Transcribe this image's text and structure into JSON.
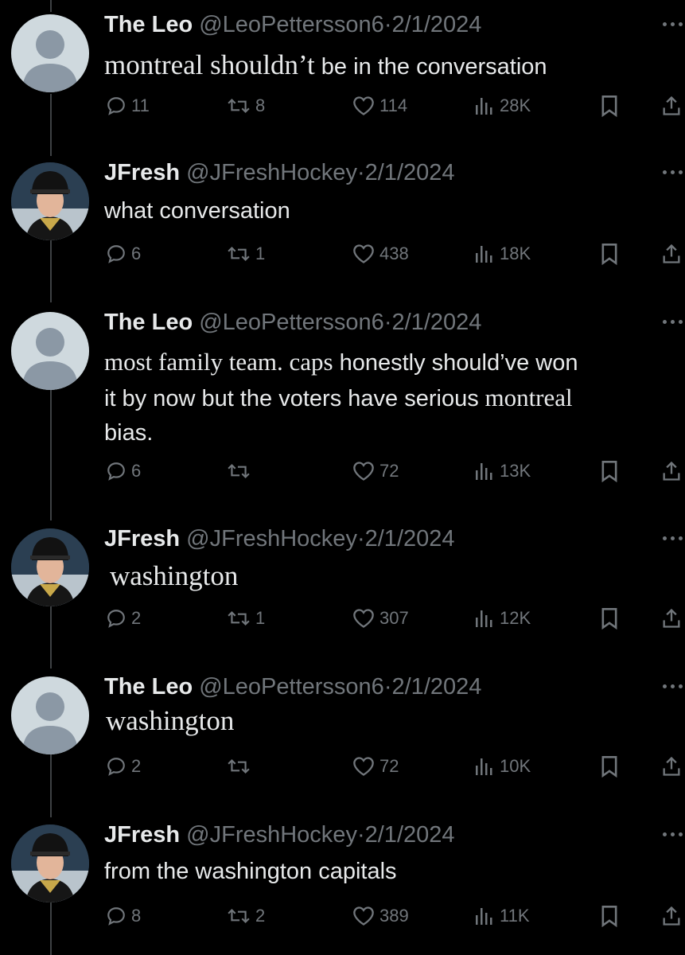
{
  "tweets": [
    {
      "author": "The Leo",
      "handle": "@LeoPettersson6",
      "date": "2/1/2024",
      "avatar": "default-avatar",
      "text_parts": [
        {
          "text": "montreal shouldn’t",
          "style": "serif"
        },
        {
          "text": " be in the conversation",
          "style": "sans"
        }
      ],
      "replies": "11",
      "retweets": "8",
      "likes": "114",
      "views": "28K"
    },
    {
      "author": "JFresh",
      "handle": "@JFreshHockey",
      "date": "2/1/2024",
      "avatar": "hockey-player-photo",
      "text_parts": [
        {
          "text": "what conversation",
          "style": "sans"
        }
      ],
      "replies": "6",
      "retweets": "1",
      "likes": "438",
      "views": "18K"
    },
    {
      "author": "The Leo",
      "handle": "@LeoPettersson6",
      "date": "2/1/2024",
      "avatar": "default-avatar",
      "text_lines": [
        [
          {
            "text": "most family team. caps",
            "style": "serif"
          },
          {
            "text": " honestly should’ve won",
            "style": "sans"
          }
        ],
        [
          {
            "text": "it by now but the voters have serious",
            "style": "sans"
          },
          {
            "text": " montreal",
            "style": "serif"
          }
        ],
        [
          {
            "text": "bias.",
            "style": "sans"
          }
        ]
      ],
      "replies": "6",
      "retweets": "",
      "likes": "72",
      "views": "13K"
    },
    {
      "author": "JFresh",
      "handle": "@JFreshHockey",
      "date": "2/1/2024",
      "avatar": "hockey-player-photo",
      "text_parts": [
        {
          "text": "washington",
          "style": "serif"
        }
      ],
      "replies": "2",
      "retweets": "1",
      "likes": "307",
      "views": "12K"
    },
    {
      "author": "The Leo",
      "handle": "@LeoPettersson6",
      "date": "2/1/2024",
      "avatar": "default-avatar",
      "text_parts": [
        {
          "text": "washington",
          "style": "serif"
        }
      ],
      "replies": "2",
      "retweets": "",
      "likes": "72",
      "views": "10K"
    },
    {
      "author": "JFresh",
      "handle": "@JFreshHockey",
      "date": "2/1/2024",
      "avatar": "hockey-player-photo",
      "text_parts": [
        {
          "text": "from the washington capitals",
          "style": "sans"
        }
      ],
      "replies": "8",
      "retweets": "2",
      "likes": "389",
      "views": "11K"
    }
  ],
  "ui": {
    "separator": "·",
    "icons": [
      "reply-icon",
      "retweet-icon",
      "like-icon",
      "views-icon",
      "bookmark-icon",
      "share-icon",
      "more-icon"
    ]
  }
}
